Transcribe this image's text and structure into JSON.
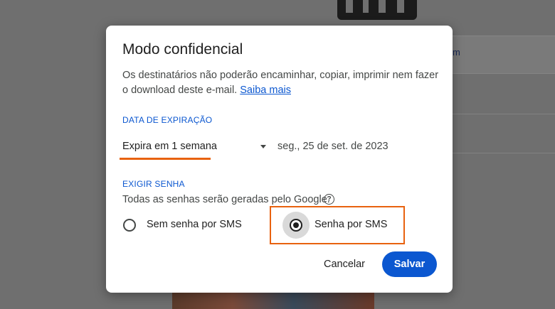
{
  "background": {
    "side_link_text": "m"
  },
  "dialog": {
    "title": "Modo confidencial",
    "description": "Os destinatários não poderão encaminhar, copiar, imprimir nem fazer o download deste e-mail.",
    "learn_more": "Saiba mais",
    "expiration": {
      "label": "DATA DE EXPIRAÇÃO",
      "selected": "Expira em 1 semana",
      "date": "seg., 25 de set. de 2023"
    },
    "password": {
      "label": "EXIGIR SENHA",
      "hint": "Todas as senhas serão geradas pelo Google.",
      "help_icon": "?",
      "options": [
        {
          "label": "Sem senha por SMS",
          "selected": false
        },
        {
          "label": "Senha por SMS",
          "selected": true
        }
      ]
    },
    "buttons": {
      "cancel": "Cancelar",
      "save": "Salvar"
    }
  },
  "colors": {
    "accent": "#0b57d0",
    "highlight": "#e8620f",
    "overlay": "#6f6f6f"
  }
}
